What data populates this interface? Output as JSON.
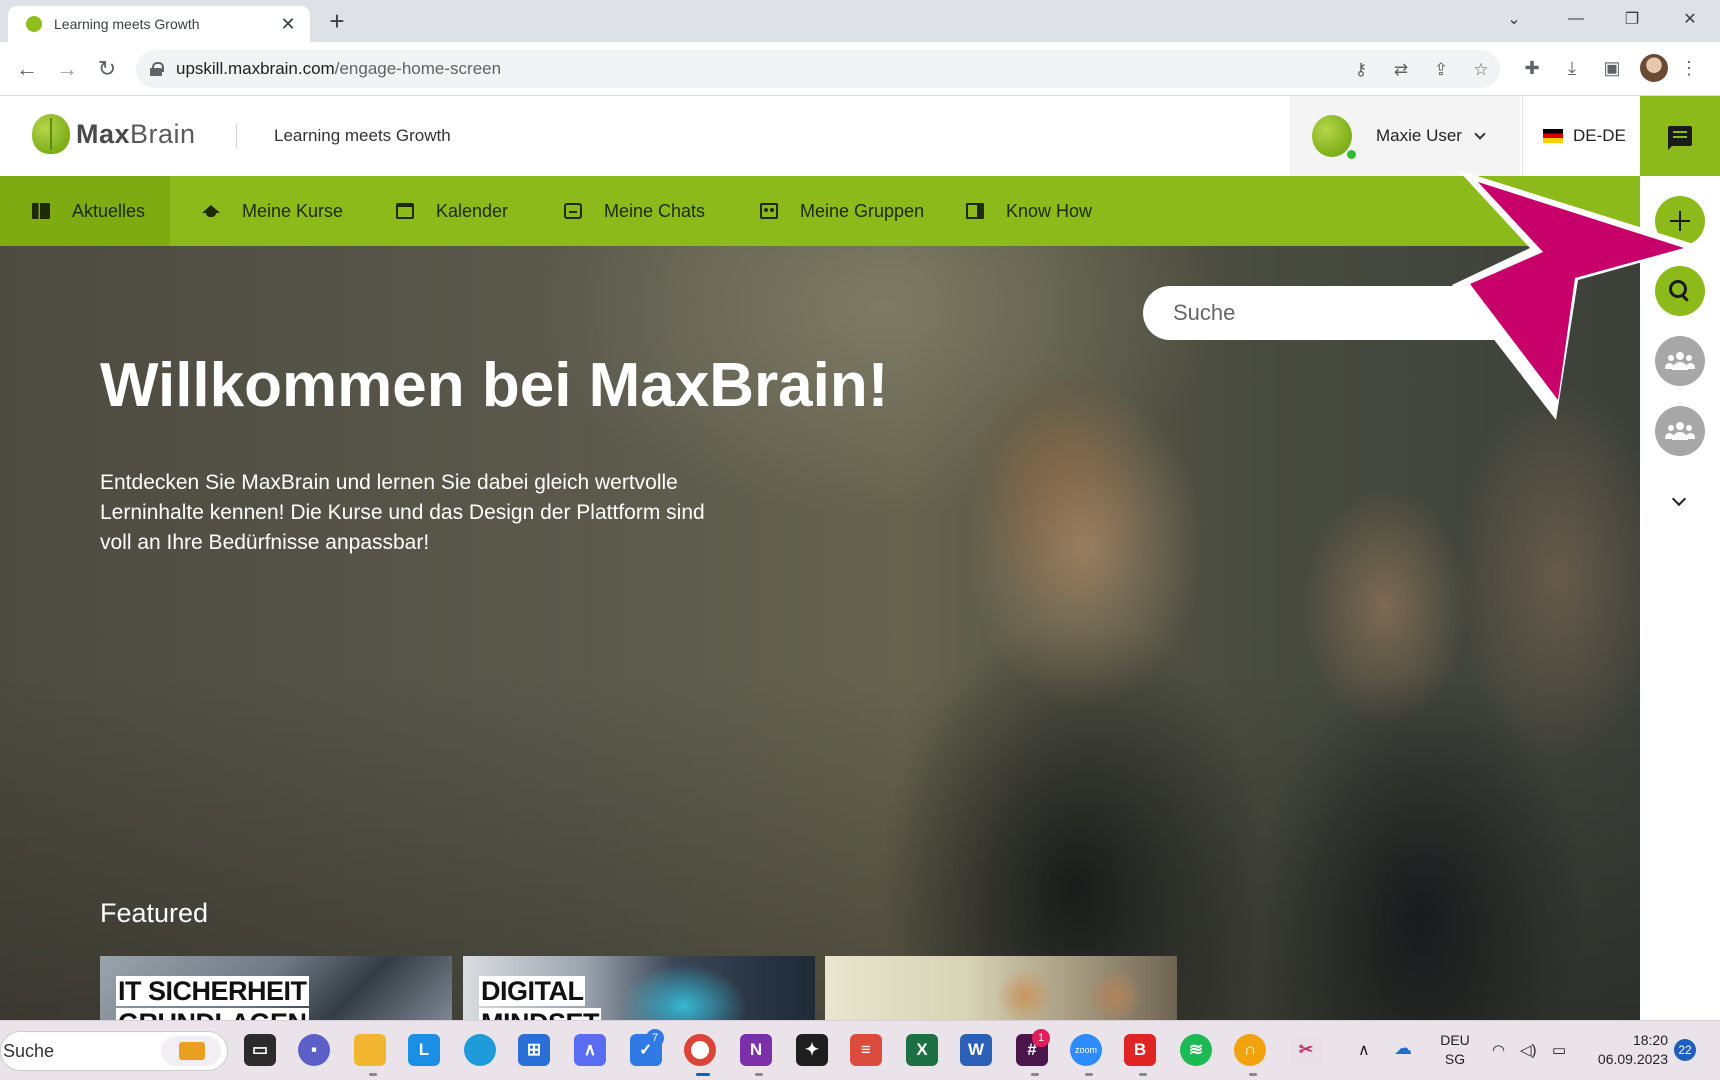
{
  "browser": {
    "tab_title": "Learning meets Growth",
    "tab_close": "✕",
    "new_tab": "+",
    "url_host": "upskill.maxbrain.com",
    "url_path": "/engage-home-screen",
    "window_controls": [
      "⌄",
      "—",
      "❐",
      "✕"
    ]
  },
  "header": {
    "logo_bold": "Max",
    "logo_light": "Brain",
    "tagline": "Learning meets Growth",
    "user_name": "Maxie User",
    "language": "DE-DE"
  },
  "nav": {
    "items": [
      {
        "label": "Aktuelles",
        "icon": "book-icon"
      },
      {
        "label": "Meine Kurse",
        "icon": "graduation-cap-icon"
      },
      {
        "label": "Kalender",
        "icon": "calendar-icon"
      },
      {
        "label": "Meine Chats",
        "icon": "chat-icon"
      },
      {
        "label": "Meine Gruppen",
        "icon": "group-icon"
      },
      {
        "label": "Know How",
        "icon": "open-book-icon"
      }
    ],
    "active": "Aktuelles"
  },
  "hero": {
    "search_placeholder": "Suche",
    "title": "Willkommen bei MaxBrain!",
    "text": "Entdecken Sie MaxBrain und lernen Sie dabei gleich wertvolle Lerninhalte kennen! Die Kurse und das Design der Plattform sind voll an Ihre Bedürfnisse anpassbar!",
    "featured_title": "Featured",
    "cards": [
      {
        "line1": "IT SICHERHEIT",
        "line2": "GRUNDLAGEN"
      },
      {
        "line1": "DIGITAL",
        "line2": "MINDSET"
      },
      {
        "line1": "",
        "line2": ""
      }
    ]
  },
  "taskbar": {
    "search": "Suche",
    "lang_top": "DEU",
    "lang_bottom": "SG",
    "time": "18:20",
    "date": "06.09.2023",
    "notifications": "22",
    "todo_badge": "7",
    "slack_badge": "1",
    "zoom_label": "zoom"
  },
  "colors": {
    "brand_green": "#8cba1a",
    "annotation_magenta": "#c8006a"
  }
}
